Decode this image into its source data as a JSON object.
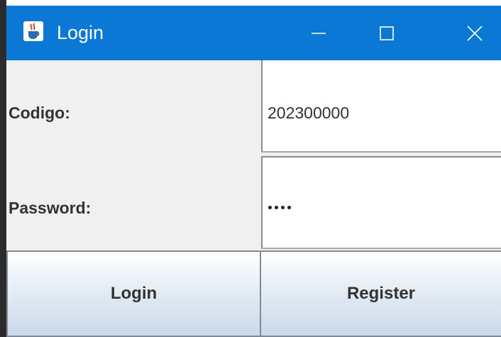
{
  "window": {
    "title": "Login",
    "title_bar_color": "#0a78d4"
  },
  "icons": {
    "app": "java-cup-icon",
    "minimize": "minimize-icon",
    "maximize": "maximize-icon",
    "close": "close-icon"
  },
  "form": {
    "codigo_label": "Codigo:",
    "codigo_value": "202300000",
    "password_label": "Password:",
    "password_masked_length": 4
  },
  "buttons": {
    "login_label": "Login",
    "register_label": "Register"
  }
}
